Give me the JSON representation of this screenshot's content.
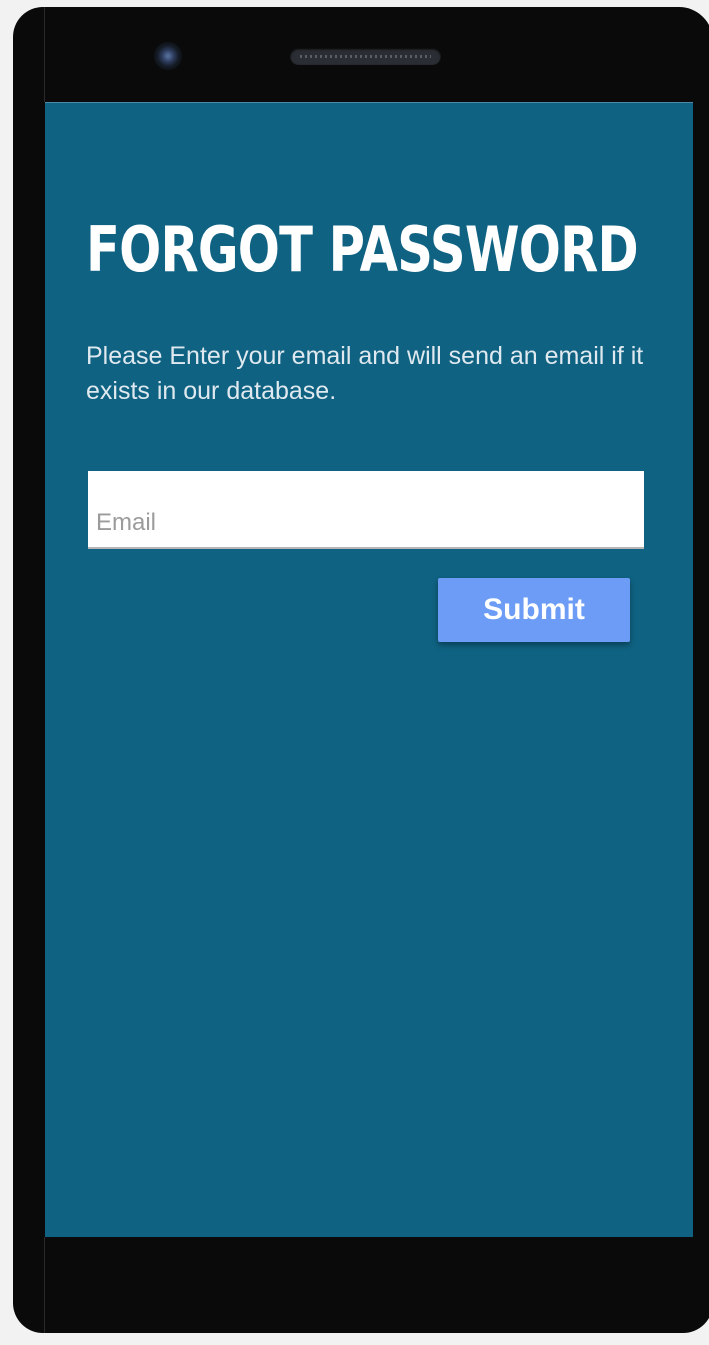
{
  "screen": {
    "title": "FORGOT PASSWORD",
    "description": "Please Enter your email and will send an email if it exists in our database.",
    "email_placeholder": "Email",
    "email_value": "",
    "submit_label": "Submit"
  },
  "colors": {
    "screen_background": "#0f6282",
    "button_background": "#6c9cf5",
    "phone_frame": "#0a0a0a"
  }
}
